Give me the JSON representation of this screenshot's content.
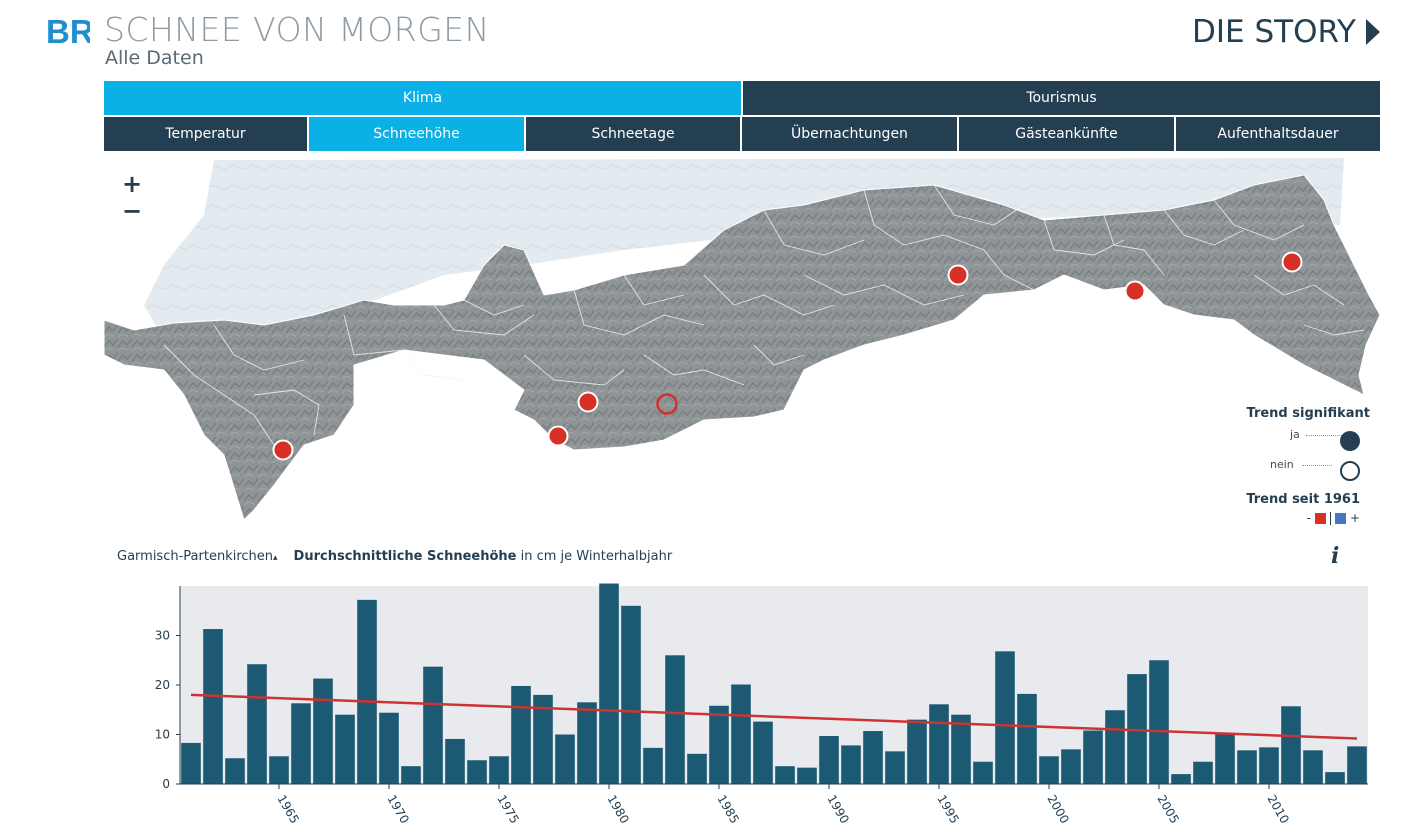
{
  "header": {
    "logo_text": "BR",
    "title": "SCHNEE VON MORGEN",
    "subtitle": "Alle Daten",
    "story_link": "DIE STORY"
  },
  "nav": {
    "primary": [
      {
        "label": "Klima",
        "active": true
      },
      {
        "label": "Tourismus",
        "active": false
      }
    ],
    "secondary": [
      {
        "label": "Temperatur",
        "active": false
      },
      {
        "label": "Schneehöhe",
        "active": true
      },
      {
        "label": "Schneetage",
        "active": false
      },
      {
        "label": "Übernachtungen",
        "active": false
      },
      {
        "label": "Gästeankünfte",
        "active": false
      },
      {
        "label": "Aufenthaltsdauer",
        "active": false
      }
    ]
  },
  "map": {
    "zoom_in": "+",
    "zoom_out": "−"
  },
  "legend": {
    "title": "Trend signifikant",
    "ja": "ja",
    "nein": "nein",
    "trend_title": "Trend seit 1961",
    "minus": "-",
    "plus": "+",
    "colors": {
      "negative": "#d63027",
      "positive": "#4a74c4",
      "marker": "#243f52"
    }
  },
  "chart_header": {
    "station": "Garmisch-Partenkirchen",
    "caret": "▴",
    "metric_bold": "Durchschnittliche Schneehöhe",
    "metric_rest": " in cm je Winterhalbjahr",
    "info": "i"
  },
  "chart_data": {
    "type": "bar",
    "x": [
      1961,
      1962,
      1963,
      1964,
      1965,
      1966,
      1967,
      1968,
      1969,
      1970,
      1971,
      1972,
      1973,
      1974,
      1975,
      1976,
      1977,
      1978,
      1979,
      1980,
      1981,
      1982,
      1983,
      1984,
      1985,
      1986,
      1987,
      1988,
      1989,
      1990,
      1991,
      1992,
      1993,
      1994,
      1995,
      1996,
      1997,
      1998,
      1999,
      2000,
      2001,
      2002,
      2003,
      2004,
      2005,
      2006,
      2007,
      2008,
      2009,
      2010,
      2011,
      2012,
      2013,
      2014
    ],
    "values": [
      8.3,
      31.3,
      5.2,
      24.2,
      5.6,
      16.3,
      21.3,
      14.0,
      37.2,
      14.4,
      3.6,
      23.7,
      9.1,
      4.8,
      5.6,
      19.8,
      18.0,
      10.0,
      16.5,
      40.5,
      36.0,
      7.3,
      26.0,
      6.1,
      15.8,
      20.1,
      12.6,
      3.6,
      3.3,
      9.7,
      7.8,
      10.7,
      6.6,
      13.0,
      16.1,
      14.0,
      4.5,
      26.8,
      18.2,
      5.6,
      7.0,
      10.8,
      14.9,
      22.2,
      25.0,
      2.0,
      4.5,
      10.2,
      6.8,
      7.4,
      15.7,
      6.8,
      2.4,
      7.6
    ],
    "x_ticks": [
      1965,
      1970,
      1975,
      1980,
      1985,
      1990,
      1995,
      2000,
      2005,
      2010
    ],
    "y_ticks": [
      0,
      10,
      20,
      30
    ],
    "ylim": [
      0,
      40
    ],
    "trend": {
      "start": 18.0,
      "end": 9.2
    },
    "colors": {
      "bar": "#1c5a74",
      "trend": "#cc3333",
      "bg": "#e8eaed"
    }
  }
}
